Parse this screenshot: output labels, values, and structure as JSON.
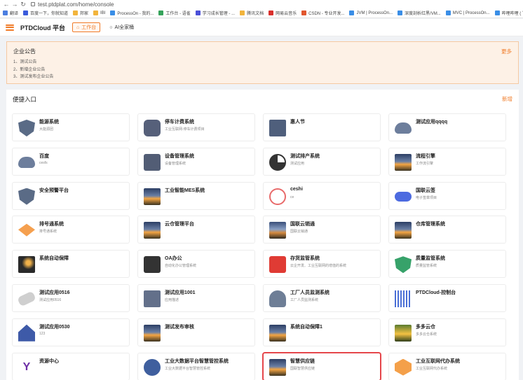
{
  "browser": {
    "url": "test.ptdplat.com/home/console",
    "bookmarks": [
      {
        "label": "翻译",
        "color": "#4a7de0"
      },
      {
        "label": "百度一下，你就知道",
        "color": "#3b5bdb"
      },
      {
        "label": "邦家",
        "color": "#f2b43c"
      },
      {
        "label": "IBI",
        "color": "#f2b43c"
      },
      {
        "label": "ProcessOn - 我的...",
        "color": "#3a8ee6"
      },
      {
        "label": "工作台 - 语雀",
        "color": "#35a25a"
      },
      {
        "label": "学习成长管理 - ...",
        "color": "#4a4fd8"
      },
      {
        "label": "腾讯文档",
        "color": "#f2b43c"
      },
      {
        "label": "网易云音乐",
        "color": "#d9302c"
      },
      {
        "label": "CSDN - 专业开发...",
        "color": "#e1562f"
      },
      {
        "label": "JVM | ProcessOn...",
        "color": "#3a8ee6"
      },
      {
        "label": "深度剖析红黑/VM...",
        "color": "#3a8ee6"
      },
      {
        "label": "MVC | ProcessOn...",
        "color": "#3a8ee6"
      },
      {
        "label": "哔哩哔哩 ( ゜- ゜)つ...",
        "color": "#3a8ee6"
      },
      {
        "label": "Sentinel: Spri",
        "color": "#d9302c"
      }
    ]
  },
  "header": {
    "brand": "PTDCloud 平台",
    "tabs": [
      {
        "label": "工作台",
        "icon": "⌂",
        "active": true
      },
      {
        "label": "AI全家桶",
        "icon": "○",
        "active": false
      }
    ]
  },
  "notice": {
    "title": "企业公告",
    "more": "更多",
    "items": [
      "1、测试公告",
      "2、新增企业公告",
      "3、测试发布企业公告"
    ]
  },
  "quick": {
    "title": "便捷入口",
    "add": "新增",
    "cards": [
      {
        "name": "能源系统",
        "desc": "大能源团",
        "icon": "shield"
      },
      {
        "name": "停车计费系统",
        "desc": "工业互联网-停车计费项目",
        "icon": "car"
      },
      {
        "name": "惠人节",
        "desc": "",
        "icon": "monitor"
      },
      {
        "name": "测试应用qqqq",
        "desc": "",
        "icon": "cloud"
      },
      {
        "name": "百度",
        "desc": "cesfs",
        "icon": "cloud"
      },
      {
        "name": "设备管理系统",
        "desc": "设备管理系统",
        "icon": "camera"
      },
      {
        "name": "测试排产系统",
        "desc": "测试应用",
        "icon": "pie"
      },
      {
        "name": "流程引擎",
        "desc": "工作流引擎",
        "icon": "photo"
      },
      {
        "name": "安全预警平台",
        "desc": "",
        "icon": "shield"
      },
      {
        "name": "工业智能MES系统",
        "desc": "",
        "icon": "photo"
      },
      {
        "name": "ceshi",
        "desc": "ce",
        "icon": "stamp"
      },
      {
        "name": "国联云签",
        "desc": "电子签章项目",
        "icon": "chain"
      },
      {
        "name": "排号通系统",
        "desc": "排号通系统",
        "icon": "cake"
      },
      {
        "name": "云仓管理平台",
        "desc": "",
        "icon": "photo"
      },
      {
        "name": "国联云销通",
        "desc": "国联云销通",
        "icon": "photo2"
      },
      {
        "name": "仓库管理系统",
        "desc": "",
        "icon": "photo"
      },
      {
        "name": "系统自动保障",
        "desc": "",
        "icon": "dark"
      },
      {
        "name": "OA办公",
        "desc": "自动化办公管理系统",
        "icon": "clip"
      },
      {
        "name": "存货监管系统",
        "desc": "云企开发、工业互联网的增值的系统",
        "icon": "red"
      },
      {
        "name": "质量监管系统",
        "desc": "质量监管系统",
        "icon": "green"
      },
      {
        "name": "测试应用0516",
        "desc": "测试应用0516",
        "icon": "pill"
      },
      {
        "name": "测试应用1001",
        "desc": "应用描述",
        "icon": "factory"
      },
      {
        "name": "工厂人员监测系统",
        "desc": "工厂人员监测系统",
        "icon": "person"
      },
      {
        "name": "PTDCloud-控制台",
        "desc": "",
        "icon": "bars"
      },
      {
        "name": "测试应用0530",
        "desc": "123",
        "icon": "house"
      },
      {
        "name": "测试发布审核",
        "desc": "",
        "icon": "photo"
      },
      {
        "name": "系统自动保障1",
        "desc": "",
        "icon": "forest2"
      },
      {
        "name": "多多云仓",
        "desc": "多多云仓系统",
        "icon": "forest"
      },
      {
        "name": "资源中心",
        "desc": "",
        "icon": "y"
      },
      {
        "name": "工业大数据平台智慧管控系统",
        "desc": "工业大数据平台智慧管控系统",
        "icon": "gear"
      },
      {
        "name": "智慧供应链",
        "desc": "国联智慧供应链",
        "icon": "photo",
        "highlight": true
      },
      {
        "name": "工业互联网代办系统",
        "desc": "工业互联网代办系统",
        "icon": "box"
      }
    ]
  }
}
